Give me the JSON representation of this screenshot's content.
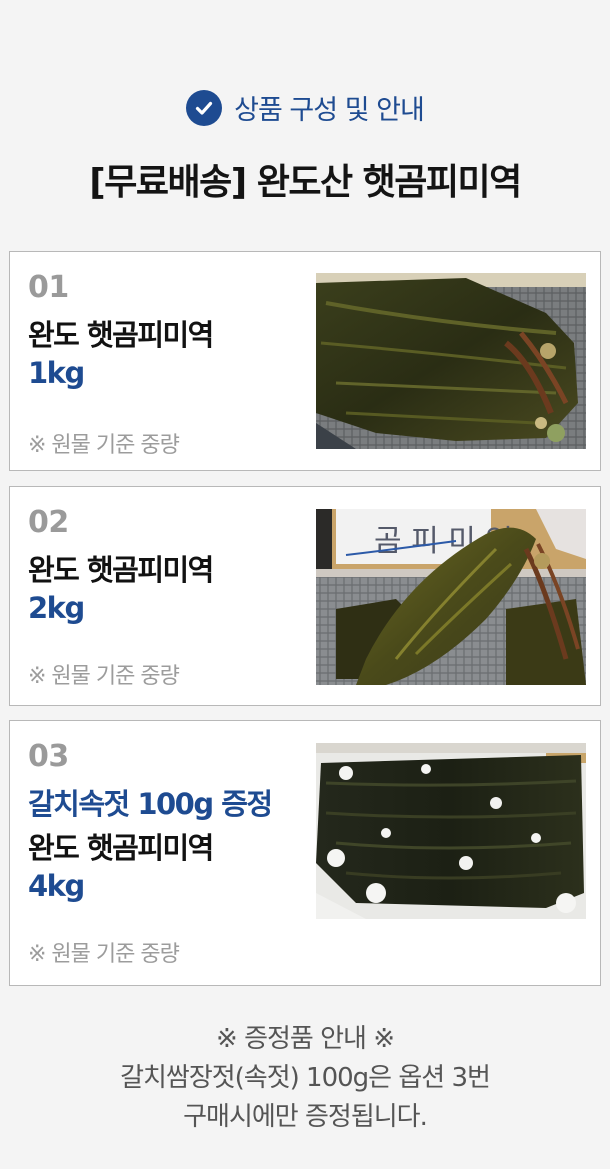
{
  "header": {
    "subtitle": "상품 구성 및 안내",
    "title": "[무료배송] 완도산 햇곰피미역",
    "icon": "check-circle-icon",
    "accent_color": "#1e4b91"
  },
  "options": [
    {
      "number": "01",
      "gift": "",
      "name": "완도 햇곰피미역",
      "weight": "1kg",
      "note": "※ 원물 기준 중량",
      "image": "seaweed-in-box-photo"
    },
    {
      "number": "02",
      "gift": "",
      "name": "완도 햇곰피미역",
      "weight": "2kg",
      "note": "※ 원물 기준 중량",
      "image": "seaweed-held-up-photo",
      "image_sign_text": "곰 피 미 역"
    },
    {
      "number": "03",
      "gift": "갈치속젓 100g 증정",
      "name": "완도 햇곰피미역",
      "weight": "4kg",
      "note": "※ 원물 기준 중량",
      "image": "seaweed-on-ice-photo"
    }
  ],
  "footer": {
    "line1": "※ 증정품 안내 ※",
    "line2": "갈치쌈장젓(속젓) 100g은 옵션 3번",
    "line3": "구매시에만 증정됩니다."
  }
}
